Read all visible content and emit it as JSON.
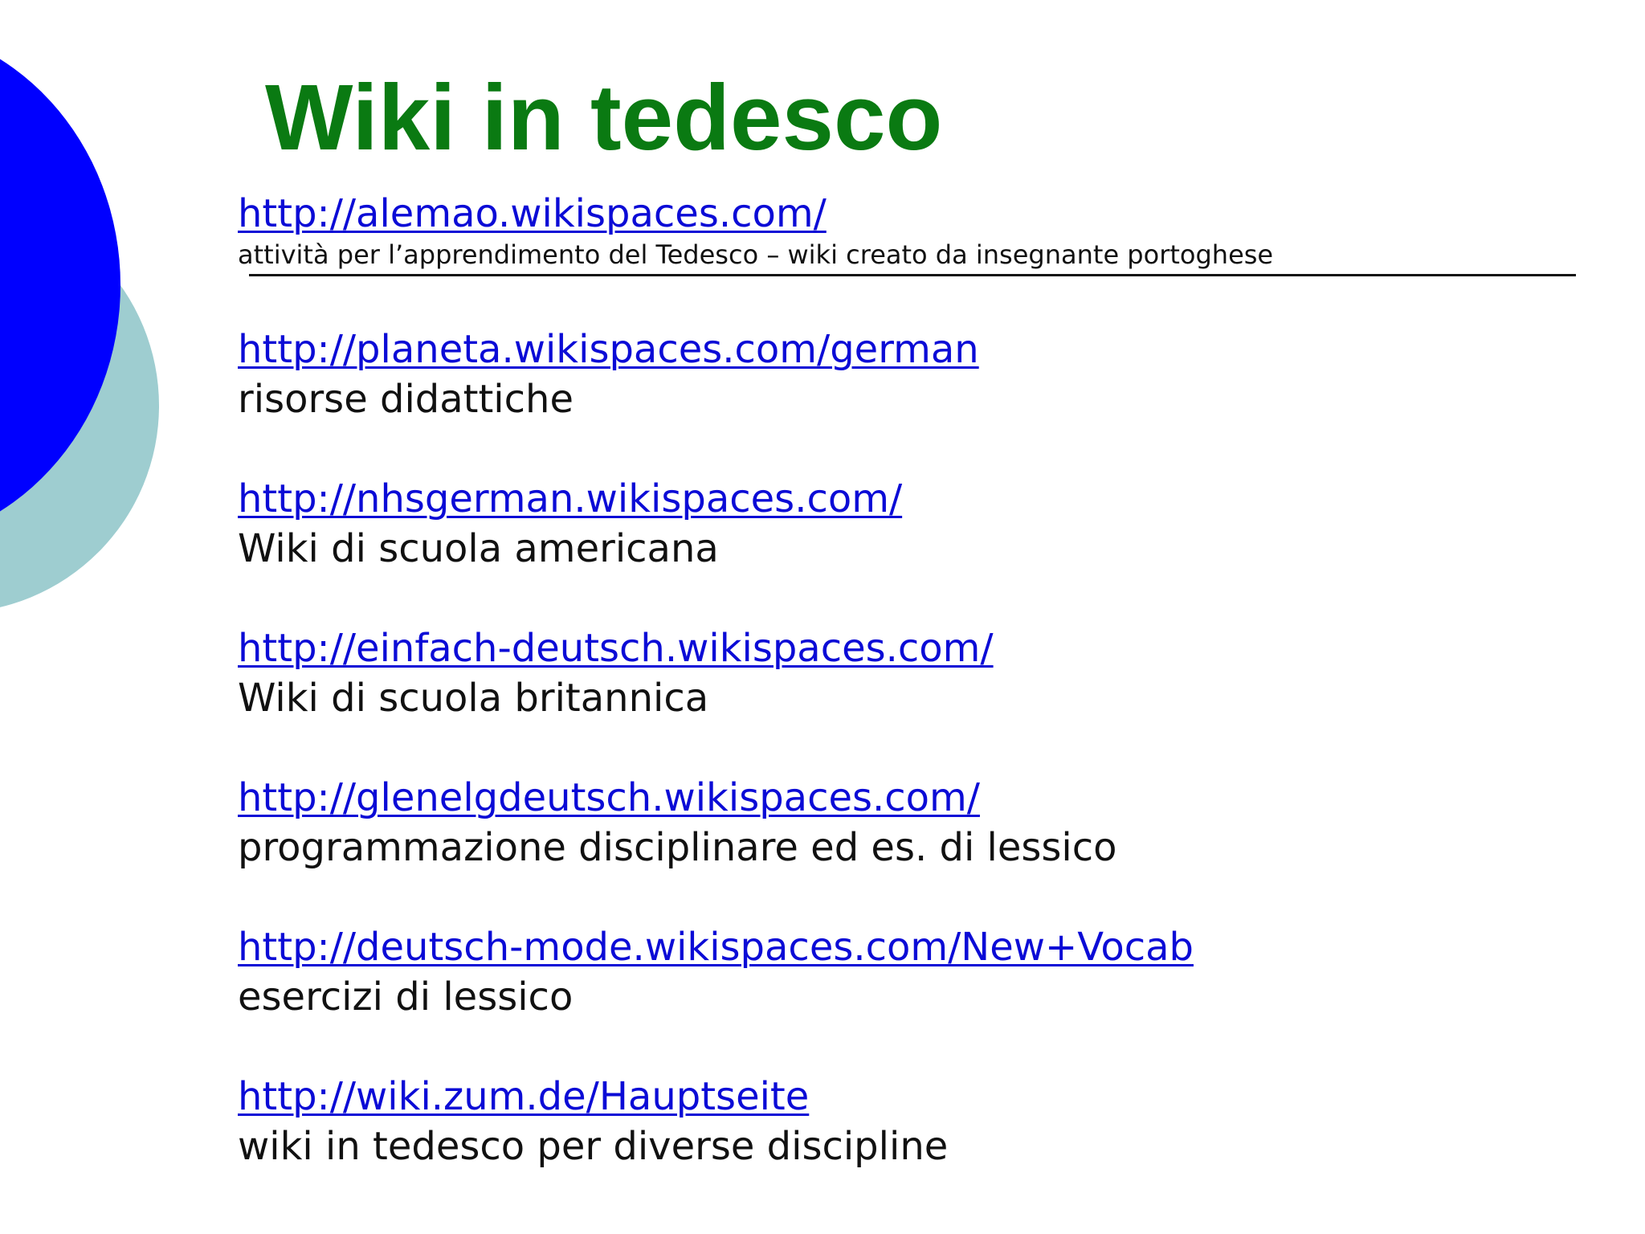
{
  "slide": {
    "title": "Wiki in tedesco",
    "colors": {
      "title": "#0a7a12",
      "link": "#0b0bd6",
      "text": "#111111",
      "circle_front": "#0000ff",
      "circle_back": "#9ecdd0"
    },
    "entries": [
      {
        "url": "http://alemao.wikispaces.com/",
        "description": "attività per l’apprendimento del Tedesco – wiki creato da  insegnante portoghese"
      },
      {
        "url": "http://planeta.wikispaces.com/german",
        "description": "risorse didattiche"
      },
      {
        "url": "http://nhsgerman.wikispaces.com/",
        "description": "Wiki di scuola americana"
      },
      {
        "url": "http://einfach-deutsch.wikispaces.com/",
        "description": "Wiki di scuola britannica"
      },
      {
        "url": "http://glenelgdeutsch.wikispaces.com/",
        "description": "programmazione disciplinare ed es. di lessico"
      },
      {
        "url": "http://deutsch-mode.wikispaces.com/New+Vocab",
        "description": "esercizi di lessico"
      },
      {
        "url": "http://wiki.zum.de/Hauptseite",
        "description": "wiki in tedesco per diverse discipline"
      }
    ]
  }
}
